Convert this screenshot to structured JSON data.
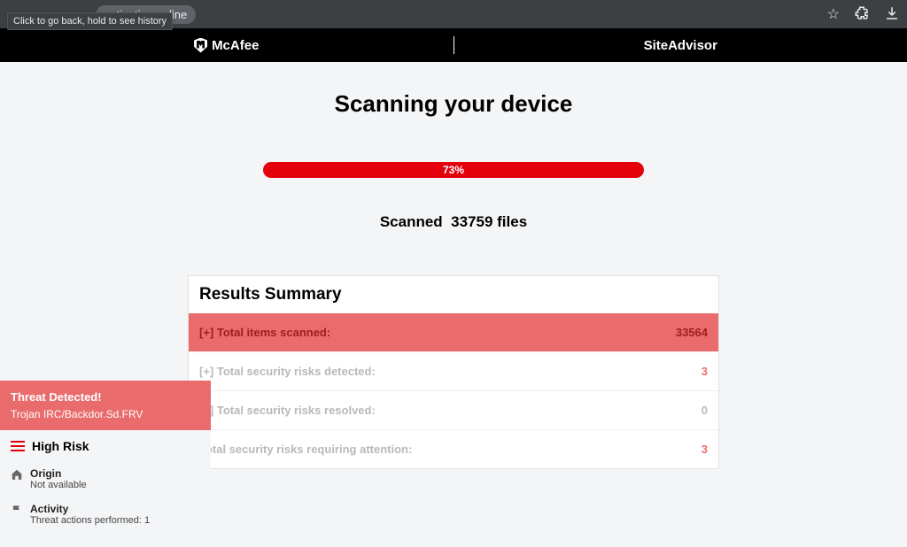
{
  "browser": {
    "url": "activation.online",
    "tooltip": "Click to go back, hold to see history"
  },
  "brand": {
    "mcafee": "McAfee",
    "siteadvisor": "SiteAdvisor"
  },
  "scan": {
    "title": "Scanning your device",
    "progress_text": "73%",
    "scanned_prefix": "Scanned",
    "scanned_count": "33759 files"
  },
  "results": {
    "header": "Results Summary",
    "rows": [
      {
        "label": "[+] Total items scanned:",
        "value": "33564"
      },
      {
        "label": "[+] Total security risks detected:",
        "value": "3"
      },
      {
        "label": "[+] Total security risks resolved:",
        "value": "0"
      },
      {
        "label": "Total security risks requiring attention:",
        "value": "3"
      }
    ]
  },
  "alert": {
    "title": "Threat Detected!",
    "detail": "Trojan IRC/Backdor.Sd.FRV",
    "risk_label": "High Risk",
    "origin_label": "Origin",
    "origin_value": "Not available",
    "activity_label": "Activity",
    "activity_value": "Threat actions performed: 1"
  }
}
